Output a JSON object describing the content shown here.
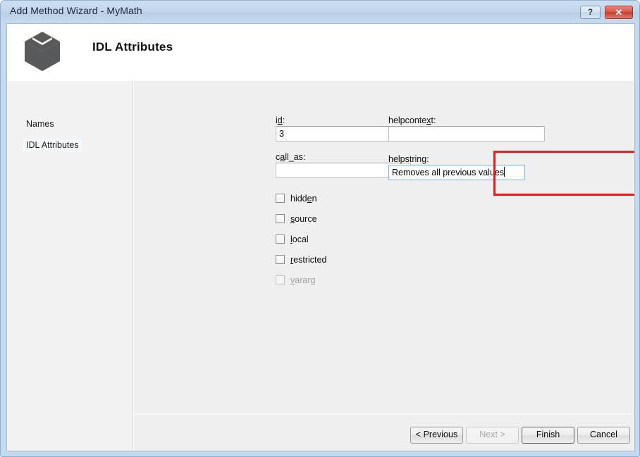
{
  "window": {
    "title": "Add Method Wizard - MyMath",
    "buttons": {
      "help_label": "?",
      "close_label": "✕"
    }
  },
  "header": {
    "title": "IDL Attributes",
    "icon": "cube-icon"
  },
  "sidebar": {
    "items": [
      {
        "label": "Names",
        "selected": false
      },
      {
        "label": "IDL Attributes",
        "selected": true
      }
    ]
  },
  "form": {
    "id_field": {
      "label_pre": "i",
      "label_accel": "d",
      "label_post": ":",
      "value": "3",
      "placeholder": ""
    },
    "call_as_field": {
      "label_pre": "c",
      "label_accel": "a",
      "label_post": "ll_as:",
      "value": "",
      "placeholder": ""
    },
    "helpcontext_field": {
      "label_pre": "helpconte",
      "label_accel": "x",
      "label_post": "t:",
      "value": "",
      "placeholder": ""
    },
    "helpstring_field": {
      "label_pre": "helpstrin",
      "label_accel": "g",
      "label_post": ":",
      "value": "Removes all previous values",
      "placeholder": ""
    },
    "checkboxes": [
      {
        "pre": "hidd",
        "accel": "e",
        "post": "n",
        "checked": false,
        "disabled": false
      },
      {
        "pre": "",
        "accel": "s",
        "post": "ource",
        "checked": false,
        "disabled": false
      },
      {
        "pre": "",
        "accel": "l",
        "post": "ocal",
        "checked": false,
        "disabled": false
      },
      {
        "pre": "",
        "accel": "r",
        "post": "estricted",
        "checked": false,
        "disabled": false
      },
      {
        "pre": "",
        "accel": "v",
        "post": "ararg",
        "checked": false,
        "disabled": true
      }
    ]
  },
  "footer": {
    "previous_label": "< Previous",
    "next_label": "Next >",
    "finish_label": "Finish",
    "cancel_label": "Cancel"
  },
  "annotation": {
    "color": "#ee1c1c",
    "target": "helpstring-field-group"
  }
}
